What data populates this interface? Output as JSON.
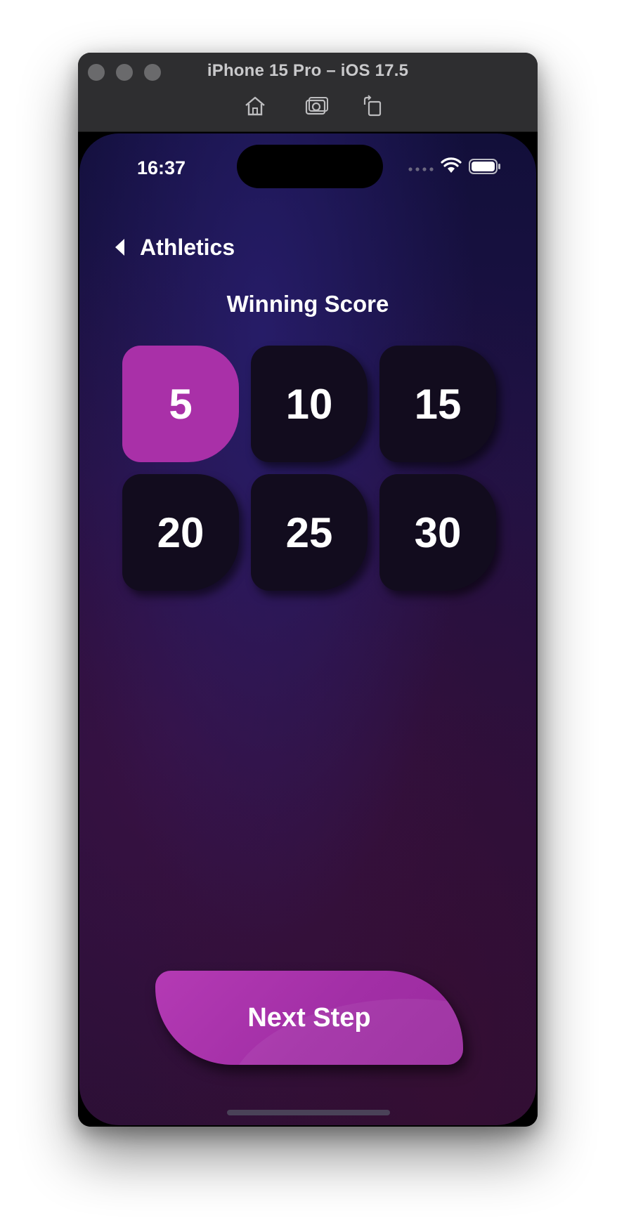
{
  "window": {
    "title": "iPhone 15 Pro – iOS 17.5",
    "toolbar_icons": [
      "home-icon",
      "screenshot-icon",
      "rotate-icon"
    ]
  },
  "status_bar": {
    "time": "16:37",
    "icons": [
      "cellular-dots-icon",
      "wifi-icon",
      "battery-icon"
    ]
  },
  "nav": {
    "back_label": "Athletics"
  },
  "section": {
    "title": "Winning Score"
  },
  "scores": [
    {
      "label": "5",
      "selected": true
    },
    {
      "label": "10",
      "selected": false
    },
    {
      "label": "15",
      "selected": false
    },
    {
      "label": "20",
      "selected": false
    },
    {
      "label": "25",
      "selected": false
    },
    {
      "label": "30",
      "selected": false
    }
  ],
  "footer": {
    "next_label": "Next Step"
  },
  "colors": {
    "accent": "#a930a8",
    "tile": "#120c1e",
    "background_top": "#120f3a",
    "background_bottom": "#2a0f34"
  }
}
